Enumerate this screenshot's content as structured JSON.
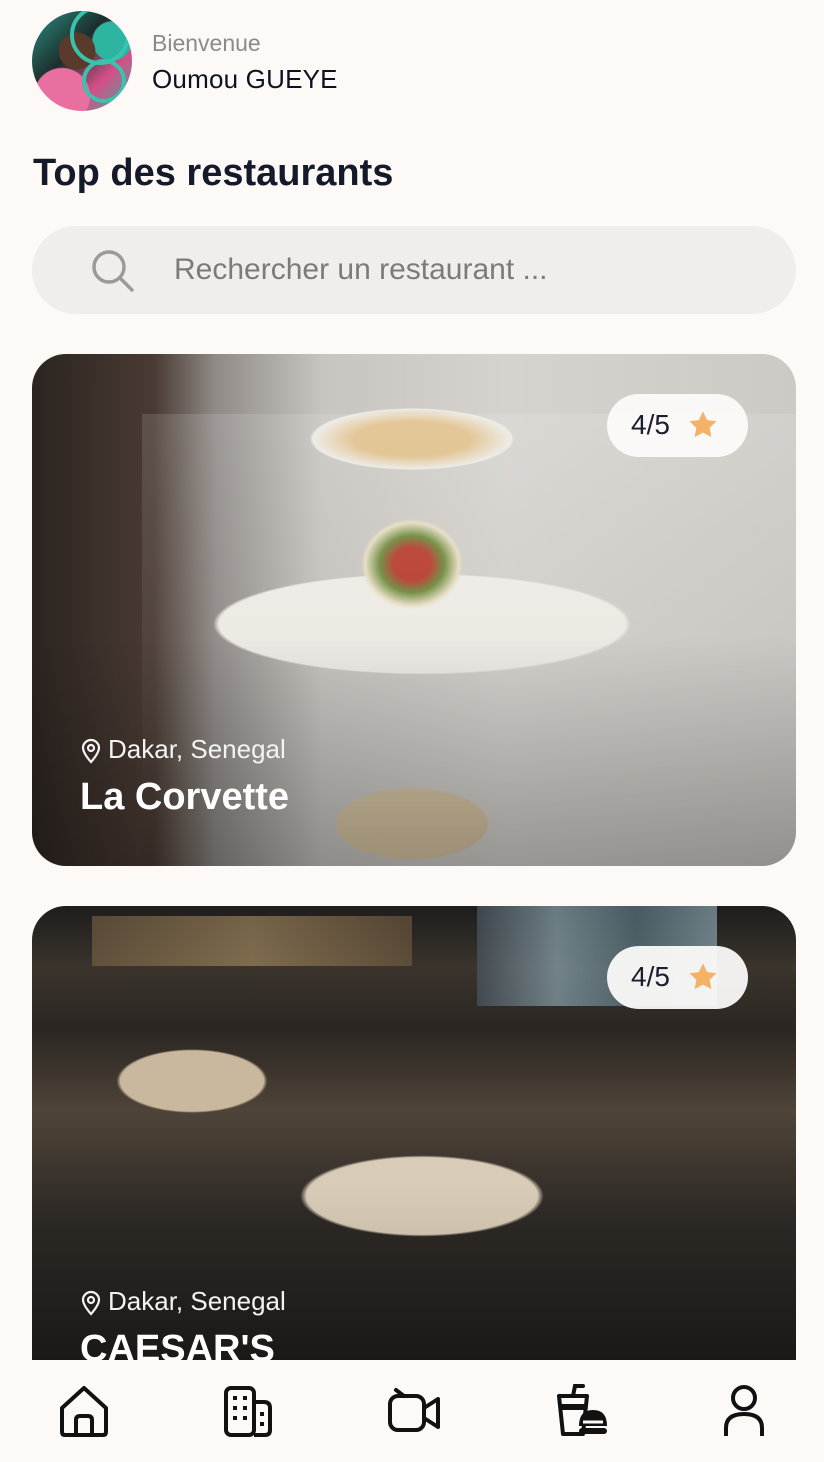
{
  "header": {
    "welcome": "Bienvenue",
    "username": "Oumou GUEYE"
  },
  "page": {
    "title": "Top des restaurants"
  },
  "search": {
    "placeholder": "Rechercher un restaurant ...",
    "value": ""
  },
  "restaurants": [
    {
      "rating": "4/5",
      "location": "Dakar, Senegal",
      "name": "La Corvette"
    },
    {
      "rating": "4/5",
      "location": "Dakar, Senegal",
      "name": "CAESAR'S"
    }
  ],
  "nav": {
    "items": [
      "home-icon",
      "buildings-icon",
      "video-camera-icon",
      "takeaway-food-icon",
      "profile-icon"
    ]
  },
  "colors": {
    "background": "#fcf9f6",
    "title": "#151a2b",
    "search_bg": "#efeeec",
    "star": "#f4b266"
  }
}
